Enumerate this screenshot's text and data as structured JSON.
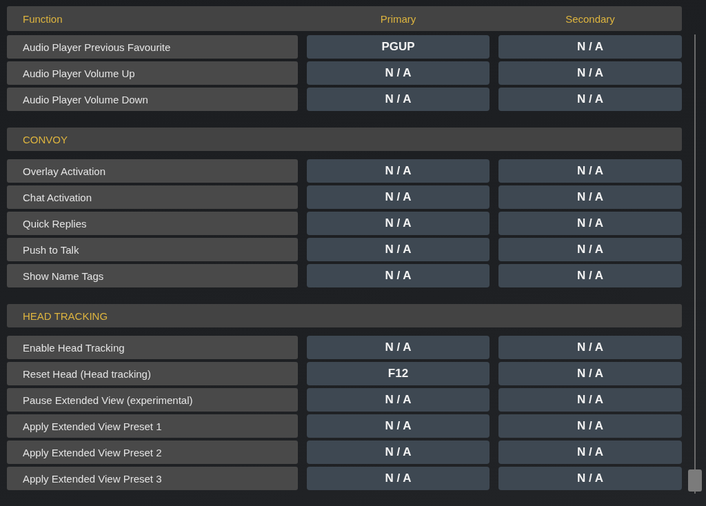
{
  "header": {
    "columns": [
      {
        "label": "Function"
      },
      {
        "label": "Primary"
      },
      {
        "label": "Secondary"
      }
    ]
  },
  "groups": [
    {
      "rows": [
        {
          "function": "Audio Player Previous Favourite",
          "primary": "PGUP",
          "secondary": "N / A"
        },
        {
          "function": "Audio Player Volume Up",
          "primary": "N / A",
          "secondary": "N / A"
        },
        {
          "function": "Audio Player Volume Down",
          "primary": "N / A",
          "secondary": "N / A"
        }
      ]
    },
    {
      "title": "CONVOY",
      "rows": [
        {
          "function": "Overlay Activation",
          "primary": "N / A",
          "secondary": "N / A"
        },
        {
          "function": "Chat Activation",
          "primary": "N / A",
          "secondary": "N / A"
        },
        {
          "function": "Quick Replies",
          "primary": "N / A",
          "secondary": "N / A"
        },
        {
          "function": "Push to Talk",
          "primary": "N / A",
          "secondary": "N / A"
        },
        {
          "function": "Show Name Tags",
          "primary": "N / A",
          "secondary": "N / A"
        }
      ]
    },
    {
      "title": "HEAD TRACKING",
      "rows": [
        {
          "function": "Enable Head Tracking",
          "primary": "N / A",
          "secondary": "N / A"
        },
        {
          "function": "Reset Head (Head tracking)",
          "primary": "F12",
          "secondary": "N / A"
        },
        {
          "function": "Pause Extended View (experimental)",
          "primary": "N / A",
          "secondary": "N / A"
        },
        {
          "function": "Apply Extended View Preset 1",
          "primary": "N / A",
          "secondary": "N / A"
        },
        {
          "function": "Apply Extended View Preset 2",
          "primary": "N / A",
          "secondary": "N / A"
        },
        {
          "function": "Apply Extended View Preset 3",
          "primary": "N / A",
          "secondary": "N / A"
        }
      ]
    }
  ]
}
